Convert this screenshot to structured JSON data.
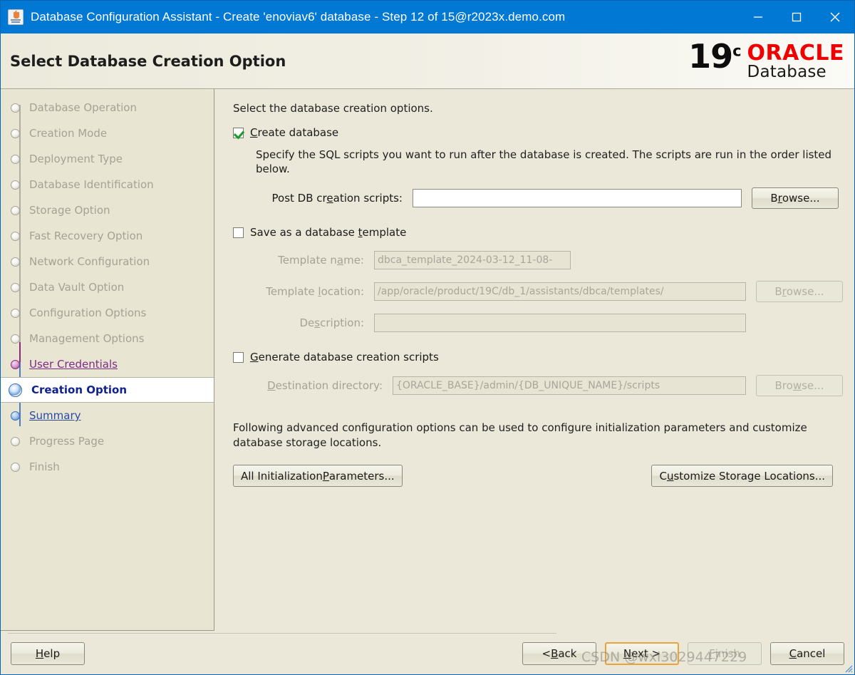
{
  "window": {
    "title": "Database Configuration Assistant - Create 'enoviav6' database - Step 12 of 15@r2023x.demo.com",
    "icon": "java-app-icon",
    "minimize_label": "Minimize",
    "maximize_label": "Maximize",
    "close_label": "Close",
    "titlebar_color": "#0078d4"
  },
  "banner": {
    "title": "Select Database Creation Option",
    "logo_version": "19",
    "logo_version_sup": "c",
    "logo_brand": "ORACLE",
    "logo_product": "Database",
    "brand_color": "#f00000"
  },
  "sidebar": {
    "items": [
      {
        "label": "Database Operation",
        "state": "disabled"
      },
      {
        "label": "Creation Mode",
        "state": "disabled"
      },
      {
        "label": "Deployment Type",
        "state": "disabled"
      },
      {
        "label": "Database Identification",
        "state": "disabled"
      },
      {
        "label": "Storage Option",
        "state": "disabled"
      },
      {
        "label": "Fast Recovery Option",
        "state": "disabled"
      },
      {
        "label": "Network Configuration",
        "state": "disabled"
      },
      {
        "label": "Data Vault Option",
        "state": "disabled"
      },
      {
        "label": "Configuration Options",
        "state": "disabled"
      },
      {
        "label": "Management Options",
        "state": "disabled"
      },
      {
        "label": "User Credentials",
        "state": "visited"
      },
      {
        "label": "Creation Option",
        "state": "current"
      },
      {
        "label": "Summary",
        "state": "link"
      },
      {
        "label": "Progress Page",
        "state": "disabled"
      },
      {
        "label": "Finish",
        "state": "disabled"
      }
    ]
  },
  "main": {
    "intro": "Select the database creation options.",
    "create_database": {
      "label": "Create database",
      "mnemonic": "C",
      "checked": true,
      "description": "Specify the SQL scripts you want to run after the database is created. The scripts are run in the order listed below.",
      "script_label_a": "Post DB cr",
      "script_label_mn": "e",
      "script_label_b": "ation scripts:",
      "script_value": "",
      "script_placeholder": "",
      "browse_a": "B",
      "browse_mn": "r",
      "browse_b": "owse..."
    },
    "save_template": {
      "label_a": "Save as a database ",
      "label_mn": "t",
      "label_b": "emplate",
      "checked": false,
      "enabled": false,
      "name_label_a": "Template n",
      "name_label_mn": "a",
      "name_label_b": "me:",
      "name_value": "dbca_template_2024-03-12_11-08-",
      "location_label_a": "Template ",
      "location_label_mn": "l",
      "location_label_b": "ocation:",
      "location_value": "/app/oracle/product/19C/db_1/assistants/dbca/templates/",
      "description_label_a": "De",
      "description_label_mn": "s",
      "description_label_b": "cription:",
      "description_value": "",
      "browse_a": "B",
      "browse_mn": "r",
      "browse_b": "owse..."
    },
    "generate_scripts": {
      "label_a": "",
      "label_mn": "G",
      "label_b": "enerate database creation scripts",
      "checked": false,
      "enabled": false,
      "dest_label_a": "",
      "dest_label_mn": "D",
      "dest_label_b": "estination directory:",
      "dest_value": "{ORACLE_BASE}/admin/{DB_UNIQUE_NAME}/scripts",
      "browse_a": "Bro",
      "browse_mn": "w",
      "browse_b": "se..."
    },
    "advanced": {
      "text": "Following advanced configuration options can be used to configure initialization parameters and customize database storage locations.",
      "init_params_a": "All Initialization ",
      "init_params_mn": "P",
      "init_params_b": "arameters...",
      "storage_a": "C",
      "storage_mn": "u",
      "storage_b": "stomize Storage Locations..."
    }
  },
  "footer": {
    "help_a": "H",
    "help_mn": "H",
    "help_b": "elp",
    "back_a": "< ",
    "back_mn": "B",
    "back_b": "ack",
    "next_a": "",
    "next_mn": "N",
    "next_b": "ext >",
    "finish_a": "",
    "finish_mn": "F",
    "finish_b": "inish",
    "cancel_a": "",
    "cancel_mn": "C",
    "cancel_b": "ancel",
    "finish_enabled": false,
    "next_focused": true
  },
  "watermark": {
    "text": "CSDN @wxl3029447229"
  }
}
